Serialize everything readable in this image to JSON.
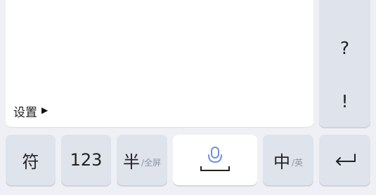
{
  "panel": {
    "settings_label": "设置",
    "settings_icon": "triangle-right-icon"
  },
  "punctuation": {
    "question": "?",
    "exclaim": "!"
  },
  "keys": {
    "symbol_label": "符",
    "numbers_label": "123",
    "half_label": "半",
    "half_sub": "/全屏",
    "voice_icon": "microphone-icon",
    "space_bar_icon": "space-bar-icon",
    "lang_label": "中",
    "lang_sub": "/英",
    "enter_icon": "enter-icon"
  },
  "colors": {
    "background": "#eef0f5",
    "key": "#dfe3ec",
    "white_key": "#ffffff",
    "mic_accent": "#6f8fe0"
  }
}
